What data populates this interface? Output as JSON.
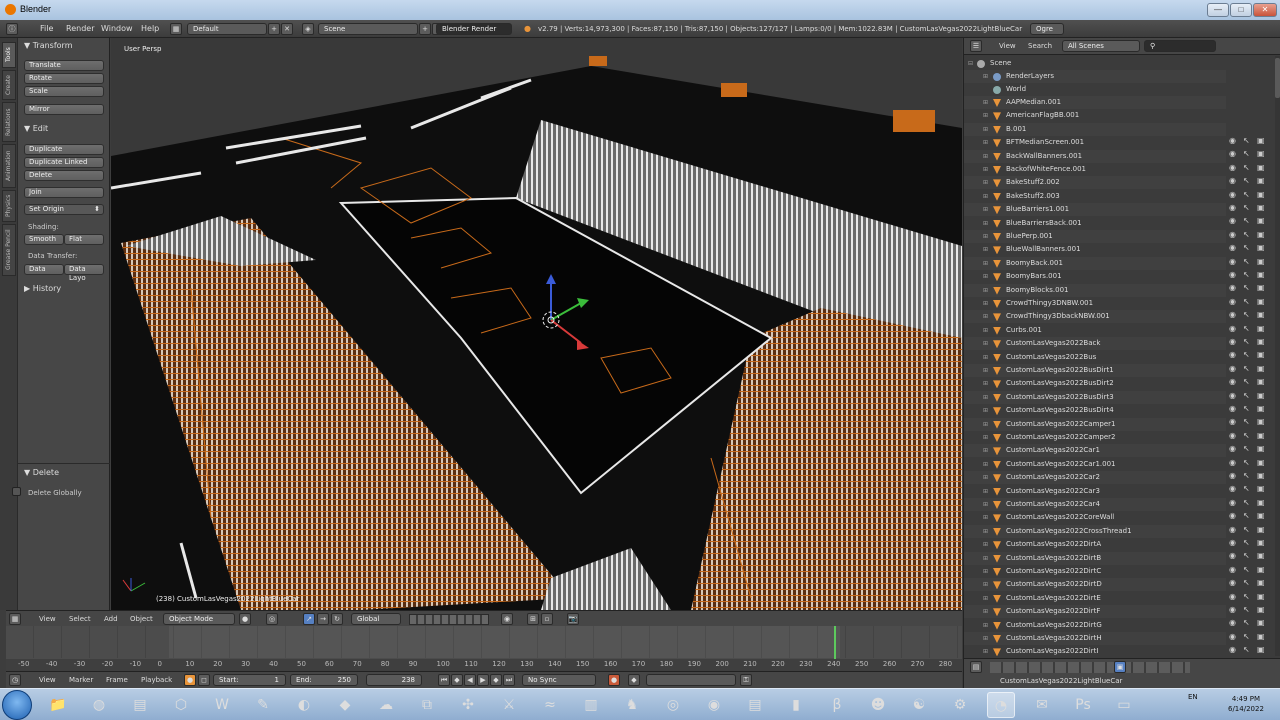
{
  "window": {
    "title": "Blender",
    "minimize": "—",
    "maximize": "□",
    "close": "✕"
  },
  "topbar": {
    "menus": [
      "File",
      "Render",
      "Window",
      "Help"
    ],
    "screen_layout": "Default",
    "scene": "Scene",
    "engine": "Blender Render",
    "stats": "v2.79 | Verts:14,973,300 | Faces:87,150 | Tris:87,150 | Objects:127/127 | Lamps:0/0 | Mem:1022.83M | CustomLasVegas2022LightBlueCar",
    "ogre": "Ogre"
  },
  "left_tabs": [
    "Tools",
    "Create",
    "Relations",
    "Animation",
    "Physics",
    "Grease Pencil"
  ],
  "tools": {
    "transform_header": "Transform",
    "translate": "Translate",
    "rotate": "Rotate",
    "scale": "Scale",
    "mirror": "Mirror",
    "edit_header": "Edit",
    "duplicate": "Duplicate",
    "duplicate_linked": "Duplicate Linked",
    "delete": "Delete",
    "join": "Join",
    "set_origin": "Set Origin",
    "shading_label": "Shading:",
    "smooth": "Smooth",
    "flat": "Flat",
    "data_transfer_label": "Data Transfer:",
    "data": "Data",
    "data_layers": "Data Layo",
    "history_header": "History",
    "delete_header": "Delete",
    "delete_globally": "Delete Globally"
  },
  "viewport": {
    "view_label": "User Persp",
    "object_label": "(238) CustomLasVegas2022LightBlueCar",
    "menus": [
      "View",
      "Select",
      "Add",
      "Object"
    ],
    "mode": "Object Mode",
    "orientation": "Global"
  },
  "timeline": {
    "ticks": [
      "-50",
      "-40",
      "-30",
      "-20",
      "-10",
      "0",
      "10",
      "20",
      "30",
      "40",
      "50",
      "60",
      "70",
      "80",
      "90",
      "100",
      "110",
      "120",
      "130",
      "140",
      "150",
      "160",
      "170",
      "180",
      "190",
      "200",
      "210",
      "220",
      "230",
      "240",
      "250",
      "260",
      "270",
      "280"
    ],
    "menus": [
      "View",
      "Marker",
      "Frame",
      "Playback"
    ],
    "start_label": "Start:",
    "start": "1",
    "end_label": "End:",
    "end": "250",
    "current": "238",
    "sync": "No Sync"
  },
  "outliner": {
    "menus": [
      "View",
      "Search"
    ],
    "filter": "All Scenes",
    "scene": "Scene",
    "render_layers": "RenderLayers",
    "world": "World",
    "objects": [
      "AAPMedian.001",
      "AmericanFlagBB.001",
      "B.001",
      "BFTMedianScreen.001",
      "BackWallBanners.001",
      "BackofWhiteFence.001",
      "BakeStuff2.002",
      "BakeStuff2.003",
      "BlueBarriers1.001",
      "BlueBarriersBack.001",
      "BluePerp.001",
      "BlueWallBanners.001",
      "BoomyBack.001",
      "BoomyBars.001",
      "BoomyBlocks.001",
      "CrowdThingy3DNBW.001",
      "CrowdThingy3DbackNBW.001",
      "Curbs.001",
      "CustomLasVegas2022Back",
      "CustomLasVegas2022Bus",
      "CustomLasVegas2022BusDirt1",
      "CustomLasVegas2022BusDirt2",
      "CustomLasVegas2022BusDirt3",
      "CustomLasVegas2022BusDirt4",
      "CustomLasVegas2022Camper1",
      "CustomLasVegas2022Camper2",
      "CustomLasVegas2022Car1",
      "CustomLasVegas2022Car1.001",
      "CustomLasVegas2022Car2",
      "CustomLasVegas2022Car3",
      "CustomLasVegas2022Car4",
      "CustomLasVegas2022CoreWall",
      "CustomLasVegas2022CrossThread1",
      "CustomLasVegas2022DirtA",
      "CustomLasVegas2022DirtB",
      "CustomLasVegas2022DirtC",
      "CustomLasVegas2022DirtD",
      "CustomLasVegas2022DirtE",
      "CustomLasVegas2022DirtF",
      "CustomLasVegas2022DirtG",
      "CustomLasVegas2022DirtH",
      "CustomLasVegas2022DirtI"
    ],
    "properties_object": "CustomLasVegas2022LightBlueCar"
  },
  "taskbar": {
    "apps": [
      "folder",
      "chrome",
      "notepad",
      "sketchup",
      "word",
      "pen",
      "blender-green",
      "sims",
      "cloud",
      "blocks",
      "network",
      "gun",
      "dolphin",
      "tv",
      "game",
      "globe",
      "chrome-dark",
      "scratch",
      "bars",
      "be",
      "avatar",
      "mask",
      "steam",
      "blender",
      "notes",
      "photoshop",
      "monitor"
    ],
    "lang": "EN",
    "time": "4:49 PM",
    "date": "6/14/2022"
  },
  "colors": {
    "accent": "#e8943a",
    "wire": "#c86a1a",
    "cursor": "#5dc95d"
  }
}
